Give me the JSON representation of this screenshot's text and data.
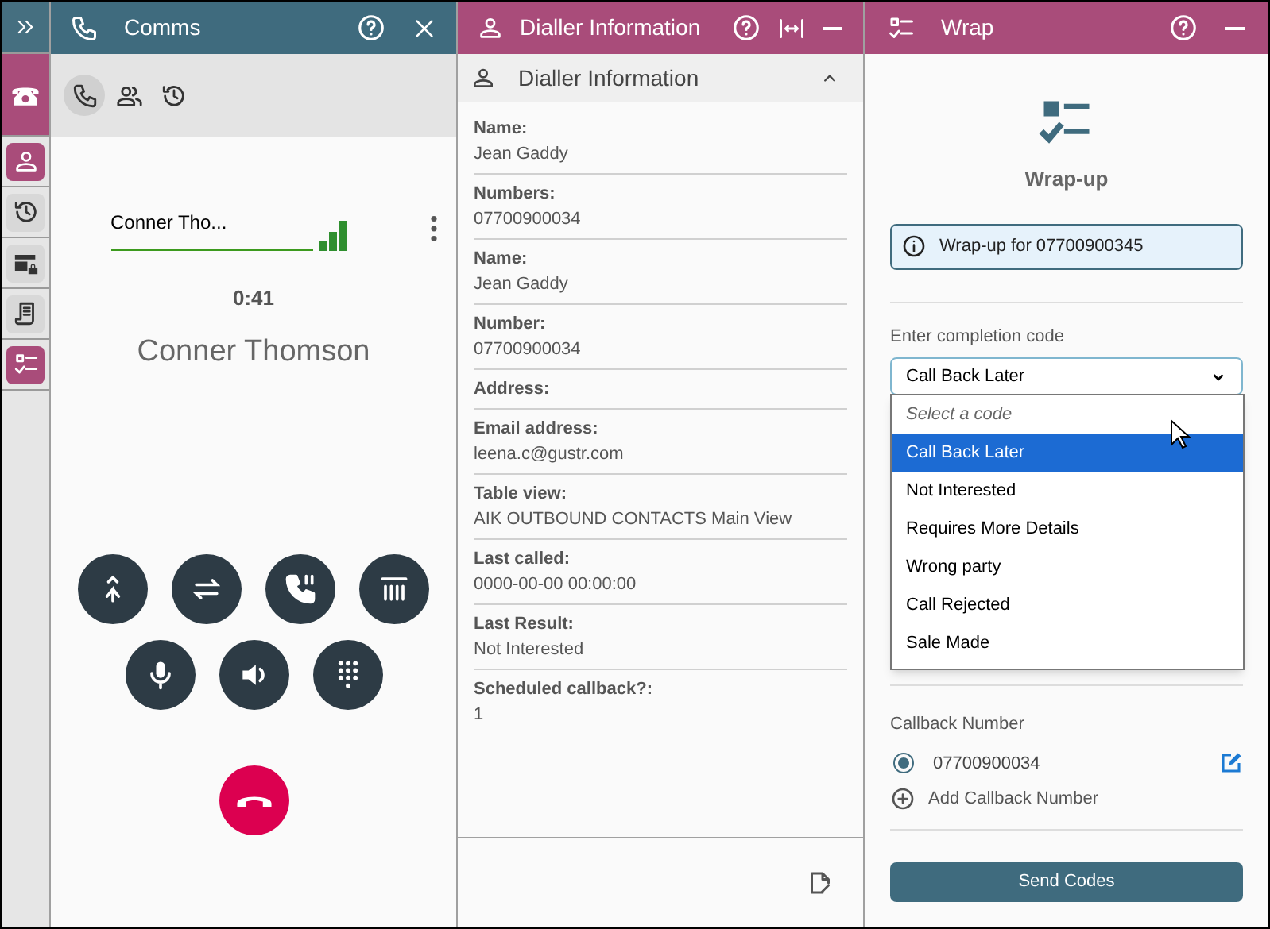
{
  "rail": {
    "items": [
      {
        "kind": "phone",
        "active": true
      },
      {
        "kind": "person",
        "active": true
      },
      {
        "kind": "history",
        "active": false
      },
      {
        "kind": "lock",
        "active": false
      },
      {
        "kind": "script",
        "active": false
      },
      {
        "kind": "checklist",
        "active": true
      }
    ]
  },
  "comms": {
    "title": "Comms",
    "tabs": [
      {
        "kind": "phone",
        "selected": true
      },
      {
        "kind": "contacts",
        "selected": false
      },
      {
        "kind": "history",
        "selected": false
      }
    ],
    "name_field": "Conner Tho...",
    "timer": "0:41",
    "caller": "Conner Thomson"
  },
  "dialler": {
    "title": "Dialler Information",
    "section": {
      "title": "Dialler Information",
      "expanded": true
    },
    "fields": [
      {
        "label": "Name:",
        "value": "Jean Gaddy"
      },
      {
        "label": "Numbers:",
        "value": "07700900034"
      },
      {
        "label": "Name:",
        "value": "Jean Gaddy"
      },
      {
        "label": "Number:",
        "value": "07700900034"
      },
      {
        "label": "Address:"
      },
      {
        "label": "Email address:",
        "value": "leena.c@gustr.com"
      },
      {
        "label": "Table view:",
        "value": "AIK OUTBOUND CONTACTS Main View"
      },
      {
        "label": "Last called:",
        "value": "0000-00-00 00:00:00"
      },
      {
        "label": "Last Result:",
        "value": "Not Interested"
      },
      {
        "label": "Scheduled callback?:",
        "value": "1"
      }
    ]
  },
  "wrap": {
    "title": "Wrap",
    "heading": "Wrap-up",
    "info": "Wrap-up for 07700900345",
    "completion": {
      "label": "Enter completion code",
      "value": "Call Back Later",
      "placeholder": "Select a code",
      "options": [
        {
          "label": "Call Back Later",
          "selected": true
        },
        {
          "label": "Not Interested",
          "selected": false
        },
        {
          "label": "Requires More Details",
          "selected": false
        },
        {
          "label": "Wrong party",
          "selected": false
        },
        {
          "label": "Call Rejected",
          "selected": false
        },
        {
          "label": "Sale Made",
          "selected": false
        }
      ]
    },
    "callback": {
      "label": "Callback Number",
      "numbers": [
        {
          "number": "07700900034",
          "selected": true
        }
      ],
      "add": "Add Callback Number"
    },
    "send_button": "Send Codes"
  }
}
